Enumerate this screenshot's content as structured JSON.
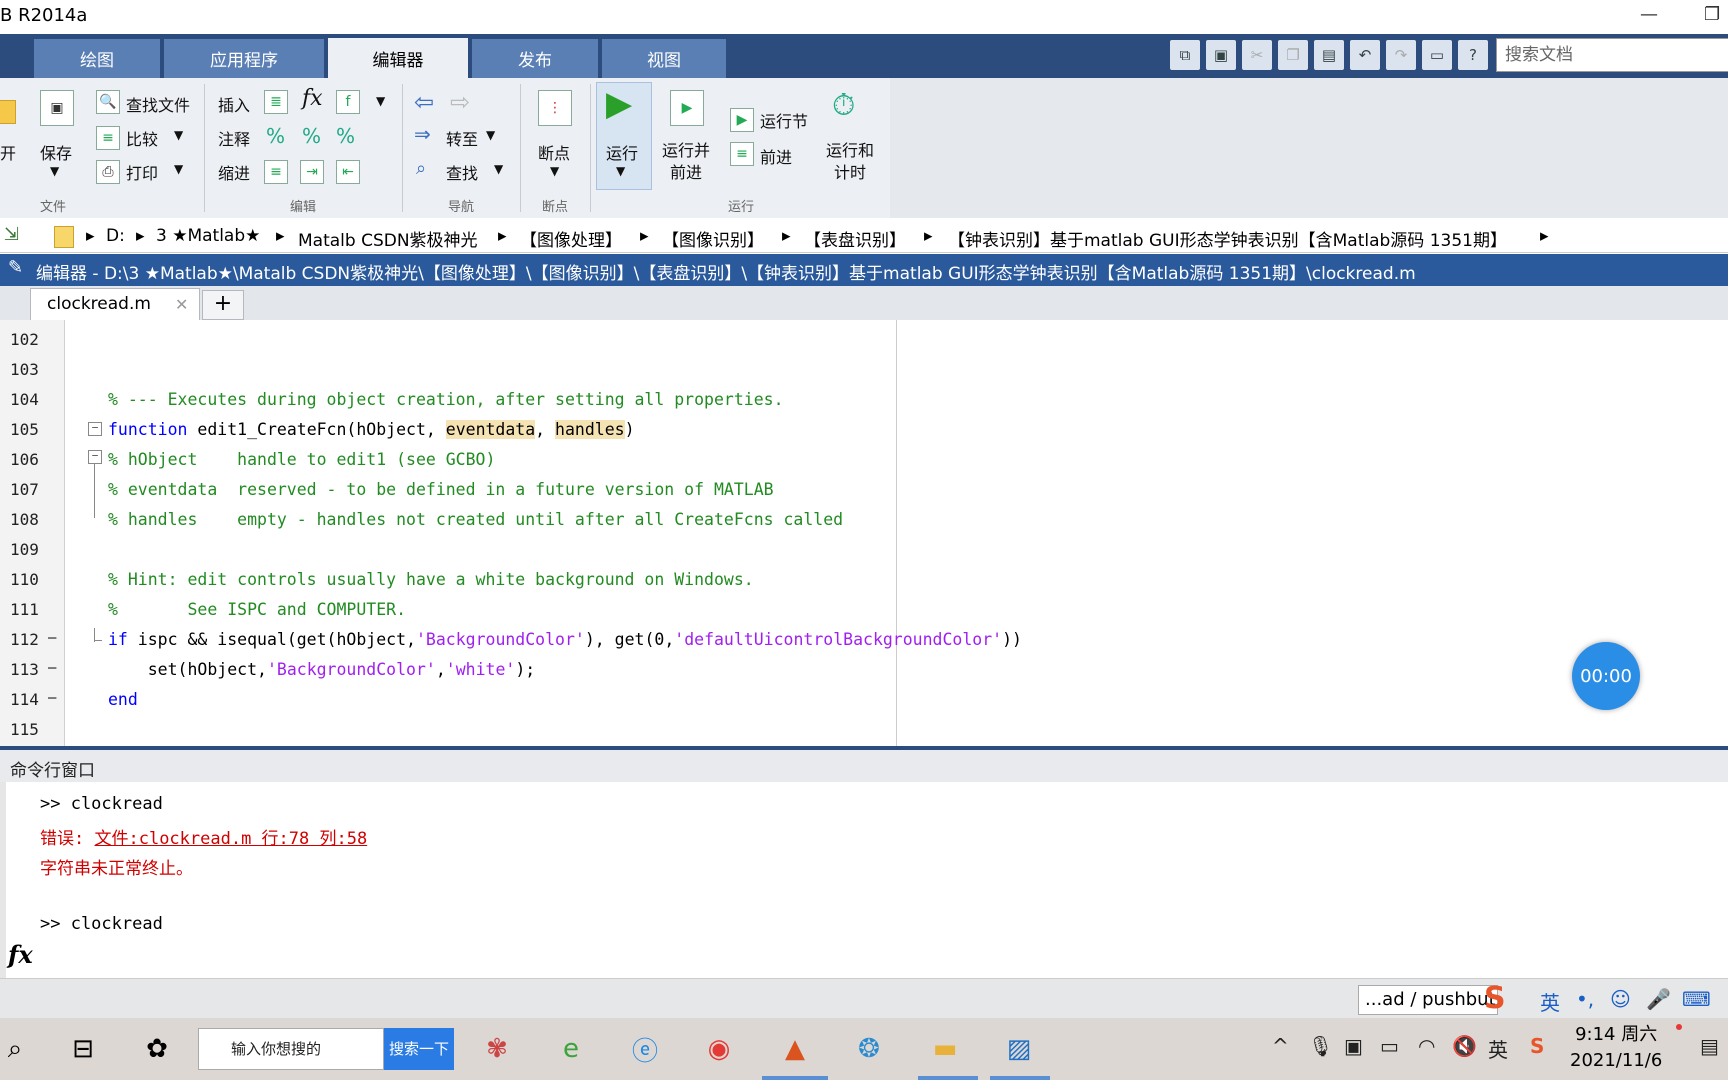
{
  "window": {
    "title": "B R2014a"
  },
  "ribbon_tabs": [
    "绘图",
    "应用程序",
    "编辑器",
    "发布",
    "视图"
  ],
  "active_tab": "编辑器",
  "search": {
    "placeholder": "搜索文档"
  },
  "ribbon": {
    "file": {
      "open_label": "开",
      "save_label": "保存",
      "find_files_label": "查找文件",
      "compare_label": "比较",
      "print_label": "打印",
      "group": "文件"
    },
    "edit": {
      "insert_label": "插入",
      "comment_label": "注释",
      "indent_label": "缩进",
      "group": "编辑"
    },
    "navigate": {
      "goto_label": "转至",
      "find_label": "查找",
      "group": "导航"
    },
    "breakpoints": {
      "label": "断点",
      "group": "断点"
    },
    "run": {
      "run_label": "运行",
      "run_advance_label": "运行并\n前进",
      "run_section_label": "运行节",
      "advance_label": "前进",
      "run_time_label": "运行和\n计时",
      "group": "运行"
    }
  },
  "breadcrumb": [
    "D:",
    "3 ★Matlab★",
    "Matalb CSDN紫极神光",
    "【图像处理】",
    "【图像识别】",
    "【表盘识别】",
    "【钟表识别】基于matlab GUI形态学钟表识别【含Matlab源码 1351期】"
  ],
  "editor": {
    "title": "编辑器 - D:\\3 ★Matlab★\\Matalb CSDN紫极神光\\【图像处理】\\【图像识别】\\【表盘识别】\\【钟表识别】基于matlab GUI形态学钟表识别【含Matlab源码 1351期】\\clockread.m",
    "file_tab": "clockread.m",
    "add_tab": "+",
    "lines": [
      {
        "n": "102",
        "marker": ""
      },
      {
        "n": "103",
        "marker": ""
      },
      {
        "n": "104",
        "marker": ""
      },
      {
        "n": "105",
        "marker": ""
      },
      {
        "n": "106",
        "marker": ""
      },
      {
        "n": "107",
        "marker": ""
      },
      {
        "n": "108",
        "marker": ""
      },
      {
        "n": "109",
        "marker": ""
      },
      {
        "n": "110",
        "marker": ""
      },
      {
        "n": "111",
        "marker": ""
      },
      {
        "n": "112",
        "marker": "—"
      },
      {
        "n": "113",
        "marker": "—"
      },
      {
        "n": "114",
        "marker": "—"
      },
      {
        "n": "115",
        "marker": ""
      }
    ],
    "code": {
      "l104": "% --- Executes during object creation, after setting all properties.",
      "l105_kw": "function",
      "l105_a": " edit1_CreateFcn(hObject, ",
      "l105_b": "eventdata",
      "l105_c": ", ",
      "l105_d": "handles",
      "l105_e": ")",
      "l106": "% hObject    handle to edit1 (see GCBO)",
      "l107": "% eventdata  reserved - to be defined in a future version of MATLAB",
      "l108": "% handles    empty - handles not created until after all CreateFcns called",
      "l110": "% Hint: edit controls usually have a white background on Windows.",
      "l111": "%       See ISPC and COMPUTER.",
      "l112_kw": "if",
      "l112_a": " ispc && isequal(get(hObject,",
      "l112_s1": "'BackgroundColor'",
      "l112_b": "), get(0,",
      "l112_s2": "'defaultUicontrolBackgroundColor'",
      "l112_c": "))",
      "l113_a": "    set(hObject,",
      "l113_s1": "'BackgroundColor'",
      "l113_b": ",",
      "l113_s2": "'white'",
      "l113_c": ");",
      "l114_kw": "end"
    }
  },
  "timer": "00:00",
  "command_window": {
    "title": "命令行窗口",
    "prompt1": ">> clockread",
    "error_prefix": "错误: ",
    "error_link": "文件:clockread.m 行:78 列:58",
    "error_msg": "字符串未正常终止。",
    "prompt2": ">> clockread",
    "fx": "fx"
  },
  "status_field": "...ad / pushbutt",
  "ime": {
    "lang": "英"
  },
  "taskbar": {
    "search_placeholder": "输入你想搜的",
    "search_button": "搜索一下",
    "time": "9:14 周六",
    "date": "2021/11/6",
    "tray_ime": "英"
  },
  "colors": {
    "tab_bar": "#2b4c7c",
    "editor_title": "#2b5a9c",
    "comment": "#228b22",
    "keyword": "#0000ff",
    "string": "#a020f0",
    "error": "#d00000"
  }
}
